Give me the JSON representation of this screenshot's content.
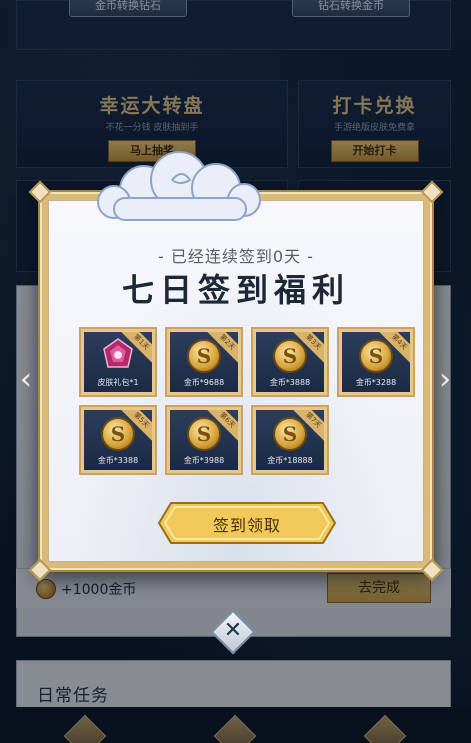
{
  "background": {
    "top_buttons": [
      "金币转换钻石",
      "钻石转换金币"
    ],
    "cards": [
      {
        "title": "幸运大转盘",
        "subtitle": "不花一分钱 皮肤抽到手",
        "button": "马上抽奖"
      },
      {
        "title": "打卡兑换",
        "subtitle": "手游绝版皮肤免费拿",
        "button": "开始打卡"
      }
    ],
    "reward": {
      "amount": "+1000金币",
      "button": "去完成"
    },
    "daily_title": "日常任务"
  },
  "modal": {
    "subtitle": "- 已经连续签到0天 -",
    "title": "七日签到福利",
    "days": [
      {
        "day_tag": "第1天",
        "label": "皮肤礼包*1",
        "icon": "gift-icon"
      },
      {
        "day_tag": "第2天",
        "label": "金币*9688",
        "icon": "coin-icon"
      },
      {
        "day_tag": "第3天",
        "label": "金币*3888",
        "icon": "coin-icon"
      },
      {
        "day_tag": "第4天",
        "label": "金币*3288",
        "icon": "coin-icon"
      },
      {
        "day_tag": "第5天",
        "label": "金币*3388",
        "icon": "coin-icon"
      },
      {
        "day_tag": "第6天",
        "label": "金币*3988",
        "icon": "coin-icon"
      },
      {
        "day_tag": "第7天",
        "label": "金币*18888",
        "icon": "coin-icon"
      }
    ],
    "claim_button": "签到领取",
    "coin_glyph": "S",
    "close_glyph": "✕"
  },
  "nav": {
    "prev_glyph": "‹",
    "next_glyph": "›"
  },
  "colors": {
    "gold": "#d8b978",
    "tile_dark": "#1b2a44",
    "title": "#1d2735"
  }
}
